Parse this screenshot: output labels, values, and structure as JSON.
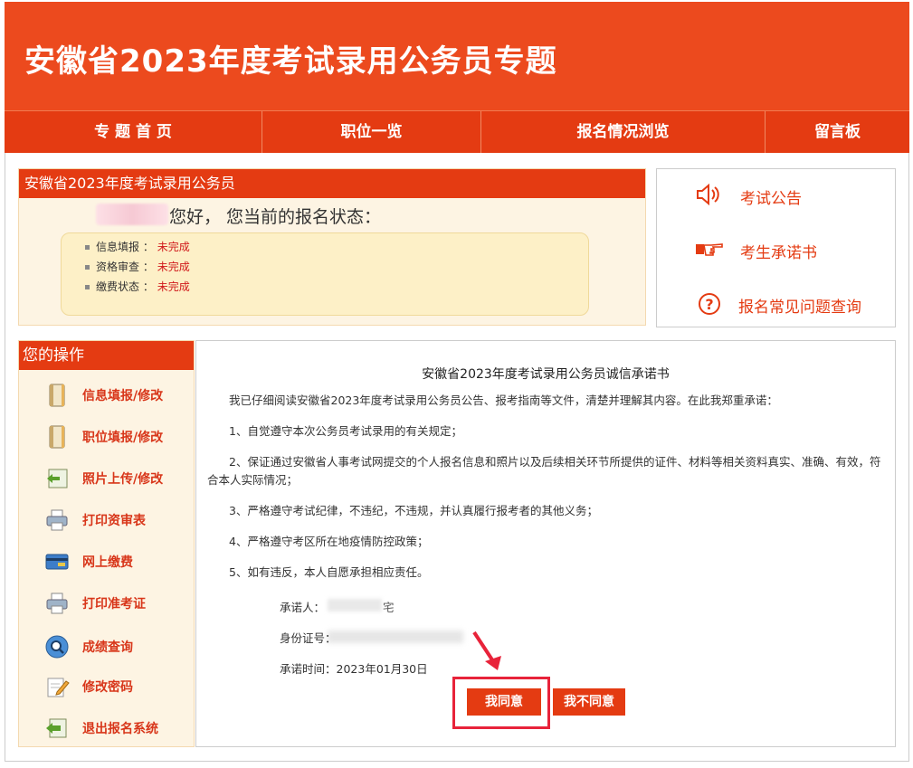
{
  "banner": {
    "title": "安徽省2023年度考试录用公务员专题"
  },
  "nav": [
    {
      "label": "专 题 首 页"
    },
    {
      "label": "职位一览"
    },
    {
      "label": "报名情况浏览"
    },
    {
      "label": "留言板"
    }
  ],
  "status": {
    "header": "安徽省2023年度考试录用公务员",
    "greeting": "您好， 您当前的报名状态：",
    "items": [
      {
        "label": "信息填报",
        "sep": "：",
        "value": "未完成"
      },
      {
        "label": "资格审查",
        "sep": "：",
        "value": "未完成"
      },
      {
        "label": "缴费状态",
        "sep": "：",
        "value": "未完成"
      }
    ]
  },
  "links": [
    {
      "label": "考试公告",
      "icon": "speaker-icon"
    },
    {
      "label": "考生承诺书",
      "icon": "pointing-hand-icon"
    },
    {
      "label": "报名常见问题查询",
      "icon": "question-icon"
    }
  ],
  "ops": {
    "header": "您的操作",
    "items": [
      {
        "label": "信息填报/修改",
        "icon": "notebook-icon"
      },
      {
        "label": "职位填报/修改",
        "icon": "notebook-icon"
      },
      {
        "label": "照片上传/修改",
        "icon": "photo-upload-icon"
      },
      {
        "label": "打印资审表",
        "icon": "printer-icon"
      },
      {
        "label": "网上缴费",
        "icon": "card-icon"
      },
      {
        "label": "打印准考证",
        "icon": "printer-icon"
      },
      {
        "label": "成绩查询",
        "icon": "magnifier-icon"
      },
      {
        "label": "修改密码",
        "icon": "edit-icon"
      },
      {
        "label": "退出报名系统",
        "icon": "exit-icon"
      }
    ]
  },
  "pledge": {
    "title": "安徽省2023年度考试录用公务员诚信承诺书",
    "intro": "我已仔细阅读安徽省2023年度考试录用公务员公告、报考指南等文件，清楚并理解其内容。在此我郑重承诺：",
    "items": [
      "1、自觉遵守本次公务员考试录用的有关规定；",
      "2、保证通过安徽省人事考试网提交的个人报名信息和照片以及后续相关环节所提供的证件、材料等相关资料真实、准确、有效，符合本人实际情况；",
      "3、严格遵守考试纪律，不违纪，不违规，并认真履行报考者的其他义务；",
      "4、严格遵守考区所在地疫情防控政策；",
      "5、如有违反，本人自愿承担相应责任。"
    ],
    "signer_label": "承诺人：",
    "signer_value": "宅",
    "id_label": "身份证号：",
    "time_label": "承诺时间：",
    "time_value": "2023年01月30日",
    "agree_label": "我同意",
    "disagree_label": "我不同意"
  },
  "colors": {
    "brand": "#e43b12",
    "banner": "#ec4a1e",
    "highlight": "#e8233a",
    "status_value": "#d0191b"
  }
}
